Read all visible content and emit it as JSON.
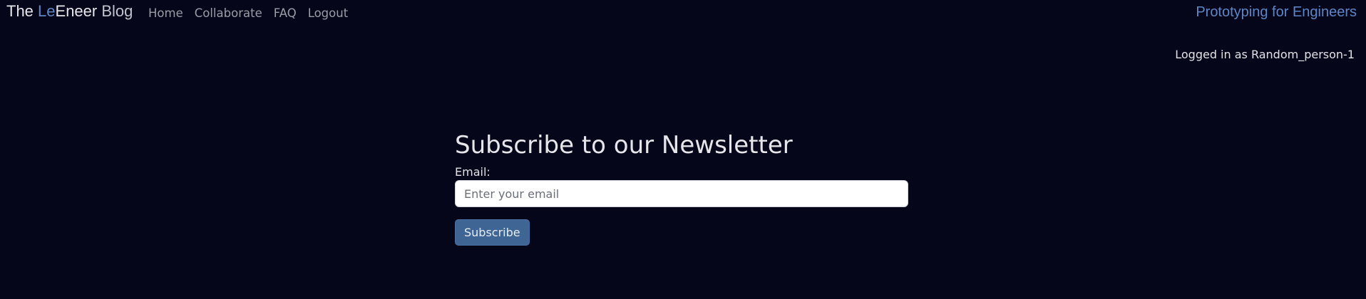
{
  "header": {
    "brand": {
      "part1": "The ",
      "accent": "Le",
      "part2": "Eneer",
      "part3": " Blog"
    },
    "nav": {
      "home": "Home",
      "collaborate": "Collaborate",
      "faq": "FAQ",
      "logout": "Logout"
    },
    "tagline": "Prototyping for Engineers",
    "login_status": "Logged in as Random_person-1"
  },
  "newsletter": {
    "title": "Subscribe to our Newsletter",
    "email_label": "Email:",
    "email_placeholder": "Enter your email",
    "email_value": "",
    "subscribe_label": "Subscribe"
  },
  "colors": {
    "background": "#06061a",
    "accent": "#5b86c6",
    "button": "#3f6594"
  }
}
